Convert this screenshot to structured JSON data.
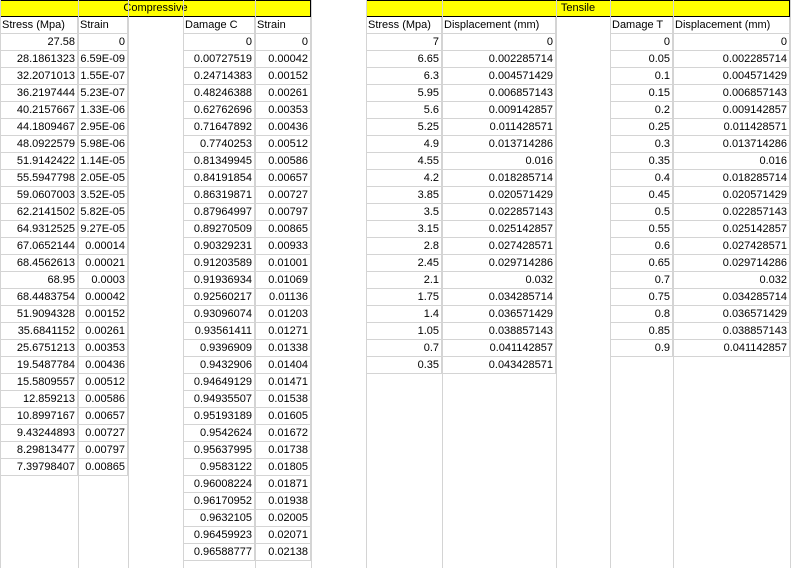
{
  "compressive": {
    "title": "Compressive",
    "headers": [
      "Stress (Mpa)",
      "Strain",
      "Damage C",
      "Strain"
    ],
    "stress_strain": [
      [
        "27.58",
        "0"
      ],
      [
        "28.1861323",
        "6.59E-09"
      ],
      [
        "32.2071013",
        "1.55E-07"
      ],
      [
        "36.2197444",
        "5.23E-07"
      ],
      [
        "40.2157667",
        "1.33E-06"
      ],
      [
        "44.1809467",
        "2.95E-06"
      ],
      [
        "48.0922579",
        "5.98E-06"
      ],
      [
        "51.9142422",
        "1.14E-05"
      ],
      [
        "55.5947798",
        "2.05E-05"
      ],
      [
        "59.0607003",
        "3.52E-05"
      ],
      [
        "62.2141502",
        "5.82E-05"
      ],
      [
        "64.9312525",
        "9.27E-05"
      ],
      [
        "67.0652144",
        "0.00014"
      ],
      [
        "68.4562613",
        "0.00021"
      ],
      [
        "68.95",
        "0.0003"
      ],
      [
        "68.4483754",
        "0.00042"
      ],
      [
        "51.9094328",
        "0.00152"
      ],
      [
        "35.6841152",
        "0.00261"
      ],
      [
        "25.6751213",
        "0.00353"
      ],
      [
        "19.5487784",
        "0.00436"
      ],
      [
        "15.5809557",
        "0.00512"
      ],
      [
        "12.859213",
        "0.00586"
      ],
      [
        "10.8997167",
        "0.00657"
      ],
      [
        "9.43244893",
        "0.00727"
      ],
      [
        "8.29813477",
        "0.00797"
      ],
      [
        "7.39798407",
        "0.00865"
      ]
    ],
    "damage_strain": [
      [
        "0",
        "0"
      ],
      [
        "0.00727519",
        "0.00042"
      ],
      [
        "0.24714383",
        "0.00152"
      ],
      [
        "0.48246388",
        "0.00261"
      ],
      [
        "0.62762696",
        "0.00353"
      ],
      [
        "0.71647892",
        "0.00436"
      ],
      [
        "0.7740253",
        "0.00512"
      ],
      [
        "0.81349945",
        "0.00586"
      ],
      [
        "0.84191854",
        "0.00657"
      ],
      [
        "0.86319871",
        "0.00727"
      ],
      [
        "0.87964997",
        "0.00797"
      ],
      [
        "0.89270509",
        "0.00865"
      ],
      [
        "0.90329231",
        "0.00933"
      ],
      [
        "0.91203589",
        "0.01001"
      ],
      [
        "0.91936934",
        "0.01069"
      ],
      [
        "0.92560217",
        "0.01136"
      ],
      [
        "0.93096074",
        "0.01203"
      ],
      [
        "0.93561411",
        "0.01271"
      ],
      [
        "0.9396909",
        "0.01338"
      ],
      [
        "0.9432906",
        "0.01404"
      ],
      [
        "0.94649129",
        "0.01471"
      ],
      [
        "0.94935507",
        "0.01538"
      ],
      [
        "0.95193189",
        "0.01605"
      ],
      [
        "0.9542624",
        "0.01672"
      ],
      [
        "0.95637995",
        "0.01738"
      ],
      [
        "0.9583122",
        "0.01805"
      ],
      [
        "0.96008224",
        "0.01871"
      ],
      [
        "0.96170952",
        "0.01938"
      ],
      [
        "0.9632105",
        "0.02005"
      ],
      [
        "0.96459923",
        "0.02071"
      ],
      [
        "0.96588777",
        "0.02138"
      ]
    ]
  },
  "tensile": {
    "title": "Tensile",
    "headers": [
      "Stress (Mpa)",
      "Displacement (mm)",
      "Damage T",
      "Displacement (mm)"
    ],
    "stress_disp": [
      [
        "7",
        "0"
      ],
      [
        "6.65",
        "0.002285714"
      ],
      [
        "6.3",
        "0.004571429"
      ],
      [
        "5.95",
        "0.006857143"
      ],
      [
        "5.6",
        "0.009142857"
      ],
      [
        "5.25",
        "0.011428571"
      ],
      [
        "4.9",
        "0.013714286"
      ],
      [
        "4.55",
        "0.016"
      ],
      [
        "4.2",
        "0.018285714"
      ],
      [
        "3.85",
        "0.020571429"
      ],
      [
        "3.5",
        "0.022857143"
      ],
      [
        "3.15",
        "0.025142857"
      ],
      [
        "2.8",
        "0.027428571"
      ],
      [
        "2.45",
        "0.029714286"
      ],
      [
        "2.1",
        "0.032"
      ],
      [
        "1.75",
        "0.034285714"
      ],
      [
        "1.4",
        "0.036571429"
      ],
      [
        "1.05",
        "0.038857143"
      ],
      [
        "0.7",
        "0.041142857"
      ],
      [
        "0.35",
        "0.043428571"
      ]
    ],
    "damage_disp": [
      [
        "0",
        "0"
      ],
      [
        "0.05",
        "0.002285714"
      ],
      [
        "0.1",
        "0.004571429"
      ],
      [
        "0.15",
        "0.006857143"
      ],
      [
        "0.2",
        "0.009142857"
      ],
      [
        "0.25",
        "0.011428571"
      ],
      [
        "0.3",
        "0.013714286"
      ],
      [
        "0.35",
        "0.016"
      ],
      [
        "0.4",
        "0.018285714"
      ],
      [
        "0.45",
        "0.020571429"
      ],
      [
        "0.5",
        "0.022857143"
      ],
      [
        "0.55",
        "0.025142857"
      ],
      [
        "0.6",
        "0.027428571"
      ],
      [
        "0.65",
        "0.029714286"
      ],
      [
        "0.7",
        "0.032"
      ],
      [
        "0.75",
        "0.034285714"
      ],
      [
        "0.8",
        "0.036571429"
      ],
      [
        "0.85",
        "0.038857143"
      ],
      [
        "0.9",
        "0.041142857"
      ]
    ]
  },
  "colors": {
    "header_band": "#ffff00",
    "gridline": "#d4d4d4"
  }
}
